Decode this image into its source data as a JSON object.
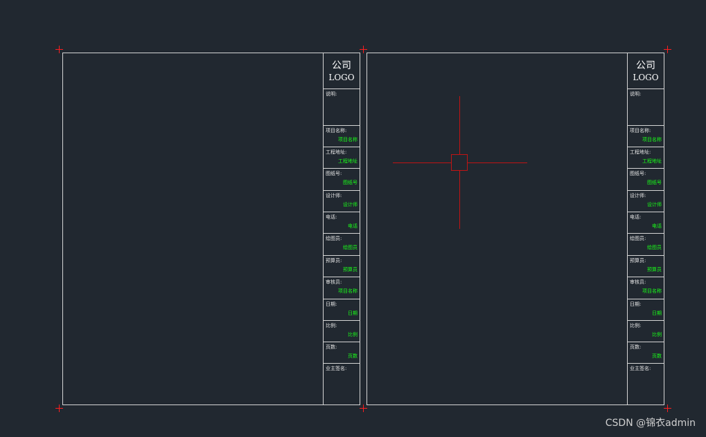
{
  "titleblock": {
    "logo_line1": "公司",
    "logo_line2": "LOGO",
    "notes_label": "说明:",
    "rows": [
      {
        "label": "项目名称:",
        "value": "项目名称"
      },
      {
        "label": "工程地址:",
        "value": "工程地址"
      },
      {
        "label": "图纸号:",
        "value": "图纸号"
      },
      {
        "label": "设计师:",
        "value": "设计师"
      },
      {
        "label": "电话:",
        "value": "电话"
      },
      {
        "label": "绘图员:",
        "value": "绘图员"
      },
      {
        "label": "预算员:",
        "value": "预算员"
      },
      {
        "label": "审核员:",
        "value": "项目名称"
      },
      {
        "label": "日期:",
        "value": "日期"
      },
      {
        "label": "比例:",
        "value": "比例"
      },
      {
        "label": "页数:",
        "value": "页数"
      },
      {
        "label": "业主签名:",
        "value": ""
      }
    ]
  },
  "colors": {
    "background": "#212830",
    "frame": "#d6d6d6",
    "field_value": "#19ff19",
    "corner_mark": "#ff1e1e",
    "crosshair": "#c21414"
  },
  "watermark": "CSDN @锦衣admin"
}
